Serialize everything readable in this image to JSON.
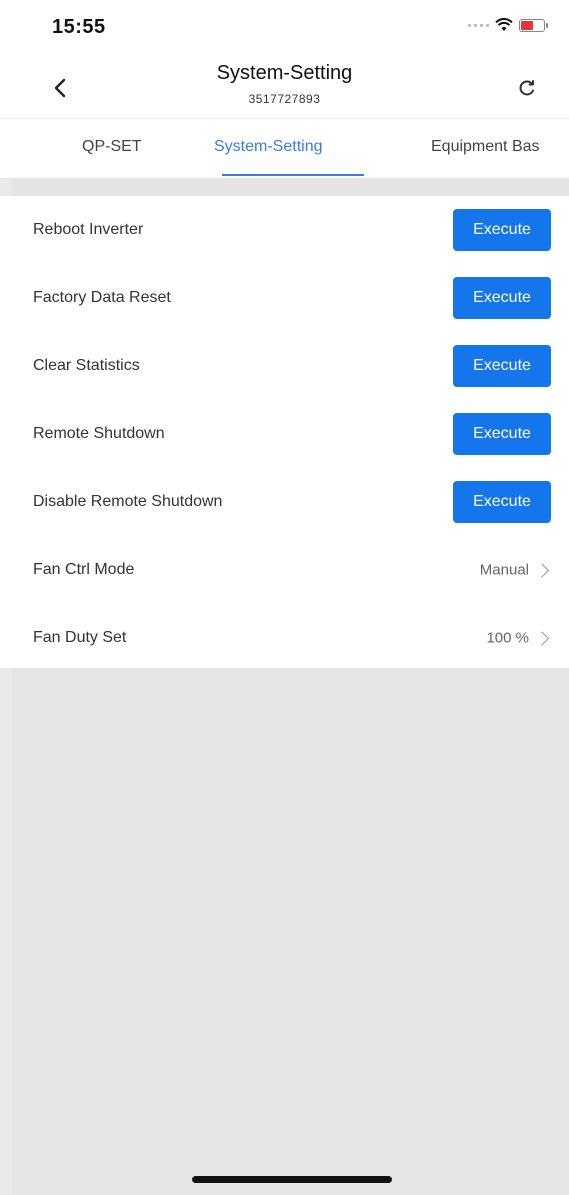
{
  "status_bar": {
    "time": "15:55"
  },
  "header": {
    "title": "System-Setting",
    "serial": "3517727893",
    "back_icon": "chevron-left-icon",
    "refresh_icon": "refresh-icon"
  },
  "tabs": [
    {
      "label": "QP-SET",
      "active": false
    },
    {
      "label": "System-Setting",
      "active": true
    },
    {
      "label": "Equipment Bas",
      "active": false
    }
  ],
  "settings": [
    {
      "label": "Reboot Inverter",
      "action": "Execute"
    },
    {
      "label": "Factory Data Reset",
      "action": "Execute"
    },
    {
      "label": "Clear Statistics",
      "action": "Execute"
    },
    {
      "label": "Remote Shutdown",
      "action": "Execute"
    },
    {
      "label": "Disable Remote Shutdown",
      "action": "Execute"
    },
    {
      "label": "Fan Ctrl Mode",
      "value": "Manual"
    },
    {
      "label": "Fan Duty Set",
      "value": "100 %"
    }
  ],
  "colors": {
    "accent": "#1576ec",
    "tab_active": "#3b7be8",
    "background": "#e9e9e9"
  }
}
